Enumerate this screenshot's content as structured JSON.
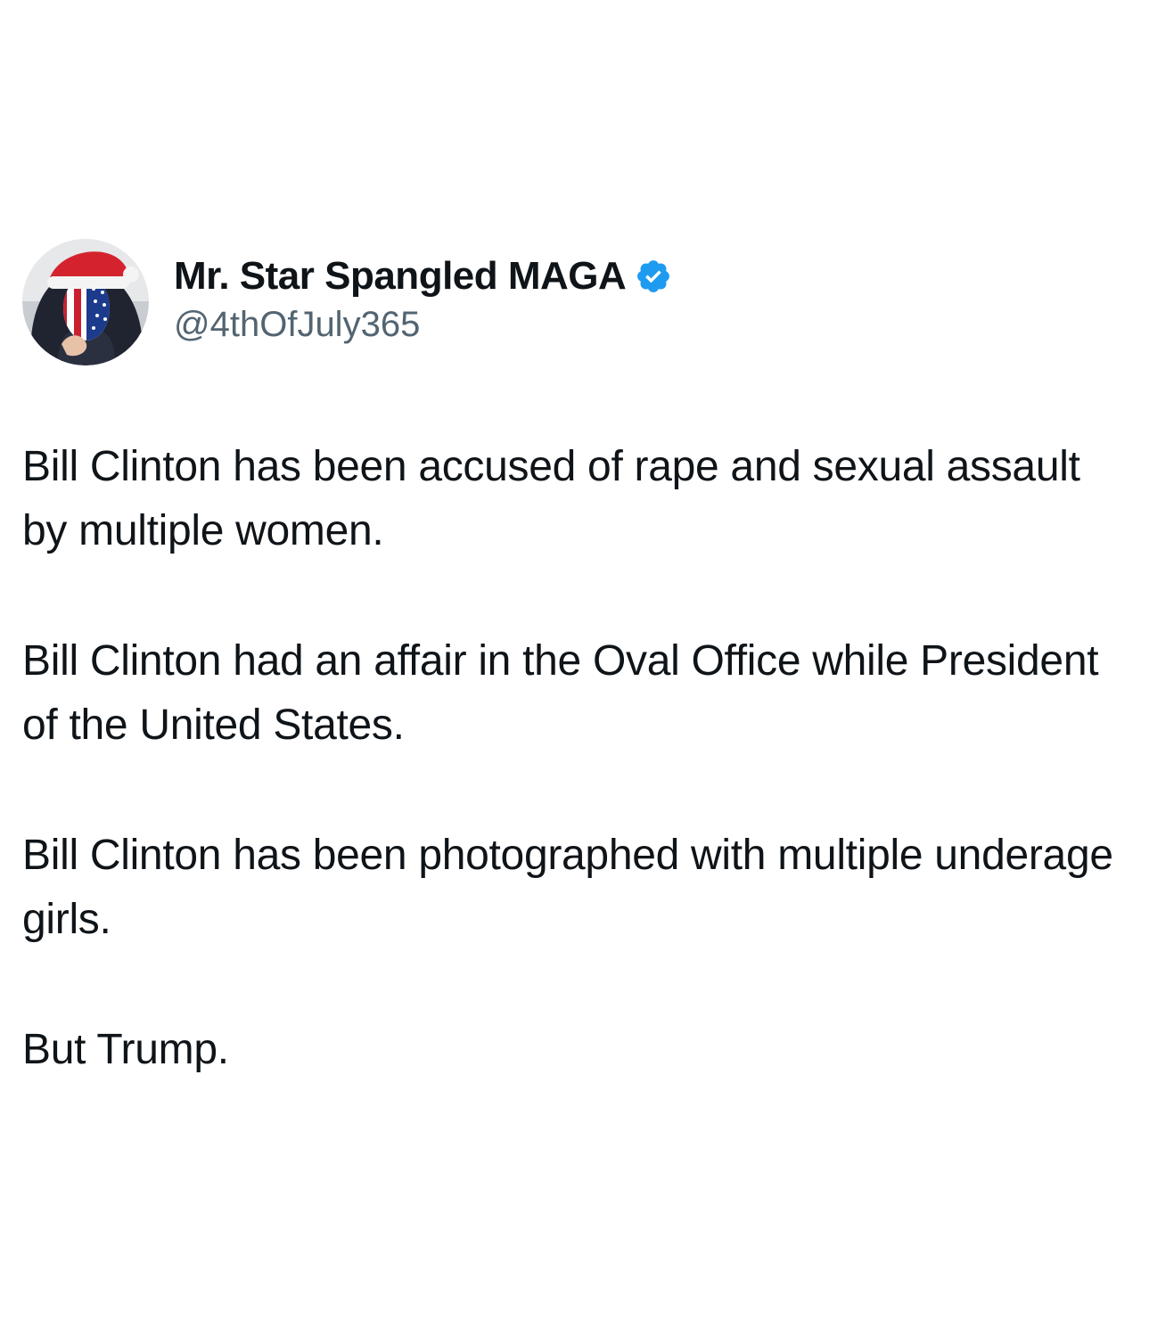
{
  "tweet": {
    "author": {
      "display_name": "Mr. Star Spangled MAGA",
      "handle": "@4thOfJuly365",
      "verified": true,
      "avatar_icon": "avatar-flag-mask-santa-hat"
    },
    "paragraphs": [
      "Bill Clinton has been accused of rape and sexual assault by multiple women.",
      "Bill Clinton had an affair in the Oval Office while President of the United States.",
      "Bill Clinton has been photographed with multiple underage girls.",
      "But Trump."
    ]
  },
  "colors": {
    "text_primary": "#0f1419",
    "text_secondary": "#536471",
    "verified_badge": "#1d9bf0",
    "background": "#ffffff"
  }
}
